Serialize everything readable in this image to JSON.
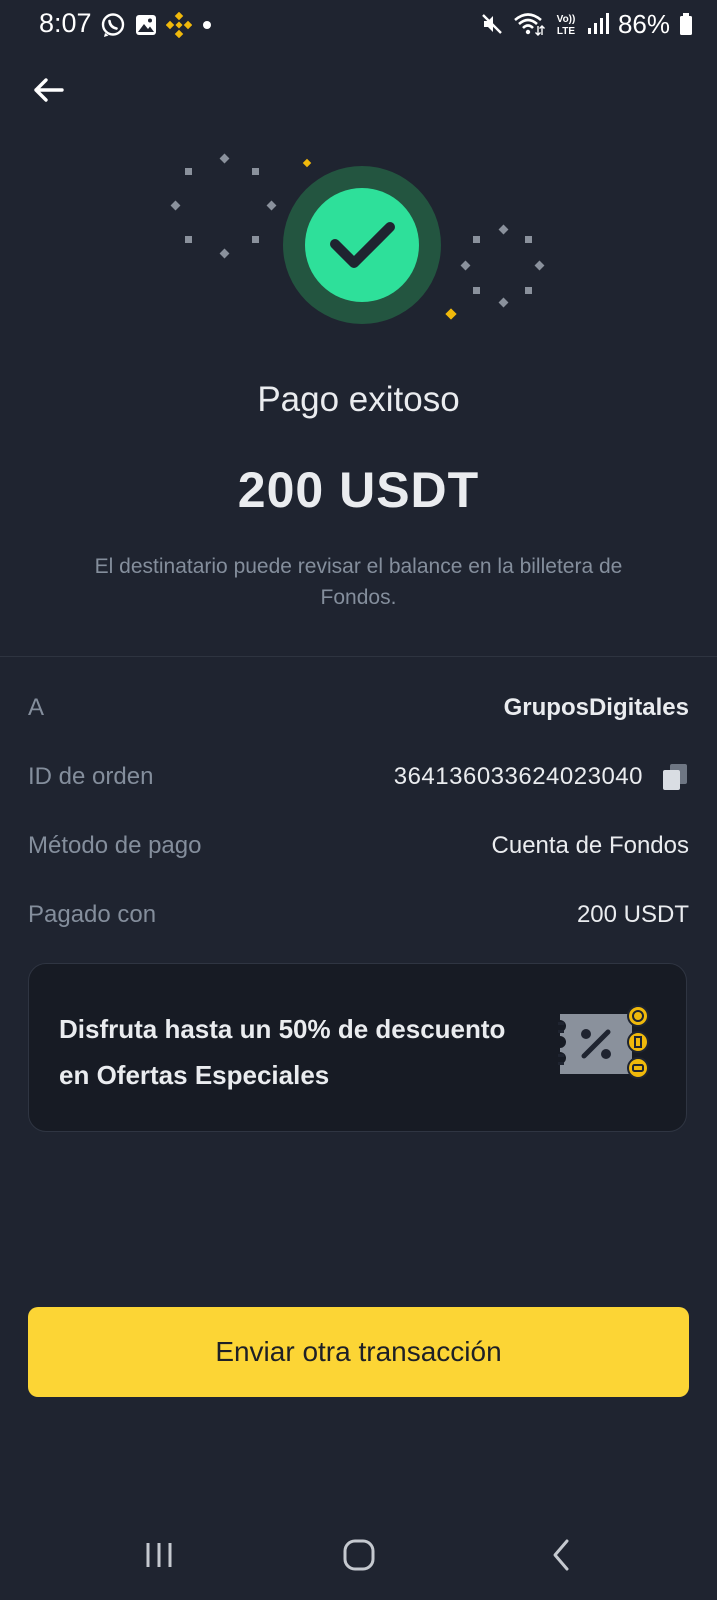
{
  "status_bar": {
    "time": "8:07",
    "battery_text": "86%",
    "left_icons": [
      "whatsapp-icon",
      "gallery-icon",
      "binance-icon",
      "notification-dot-icon"
    ],
    "right_icons": [
      "mute-icon",
      "wifi-icon",
      "volte-icon",
      "signal-icon",
      "battery-icon"
    ]
  },
  "header": {
    "back_icon": "arrow-left-icon"
  },
  "result": {
    "title": "Pago exitoso",
    "amount": "200 USDT",
    "subtitle": "El destinatario puede revisar el balance en la billetera de Fondos.",
    "status_icon": "success-check-icon"
  },
  "details": [
    {
      "label": "A",
      "value": "GruposDigitales"
    },
    {
      "label": "ID de orden",
      "value": "364136033624023040"
    },
    {
      "label": "Método de pago",
      "value": "Cuenta de Fondos"
    },
    {
      "label": "Pagado con",
      "value": "200 USDT"
    }
  ],
  "promo": {
    "text": "Disfruta hasta un 50% de descuento en Ofertas Especiales",
    "icon": "discount-coupon-icon"
  },
  "primary_button": {
    "label": "Enviar otra transacción"
  },
  "nav_bar": {
    "items": [
      "recent-apps-icon",
      "home-icon",
      "back-icon"
    ]
  },
  "colors": {
    "background": "#1f2430",
    "accent_yellow": "#fcd535",
    "success_green": "#2ee09a",
    "muted_text": "#848e9c"
  }
}
